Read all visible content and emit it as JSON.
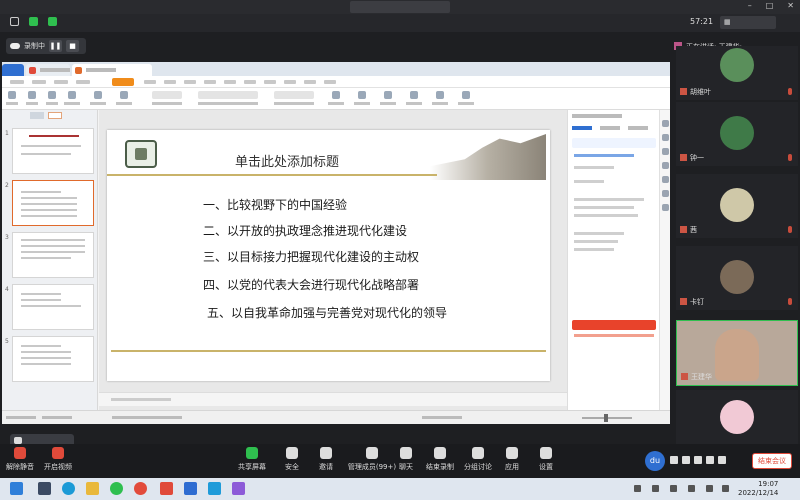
{
  "meeting": {
    "time": "57:21",
    "recording_label": "录制中",
    "speaking_label": "正在讲话: 王建华;"
  },
  "slide": {
    "title": "单击此处添加标题",
    "items": [
      "一、比较视野下的中国经验",
      "二、以开放的执政理念推进现代化建设",
      "三、以目标接力把握现代化建设的主动权",
      "四、以党的代表大会进行现代化战略部署",
      "五、以自我革命加强与完善党对现代化的领导"
    ]
  },
  "participants": [
    {
      "name": "胡维叶",
      "color": "#5a8f5b"
    },
    {
      "name": "钟一",
      "color": "#3f7a48"
    },
    {
      "name": "茜",
      "color": "#cfc8a8"
    },
    {
      "name": "卡钉",
      "color": "#7b6a58"
    },
    {
      "name": "王建华",
      "color": "#caa58b"
    },
    {
      "name": "",
      "color": "#f1c9d5"
    }
  ],
  "toolbar": {
    "unmute": "解除静音",
    "video": "开启视频",
    "share": "共享屏幕",
    "security": "安全",
    "invite": "邀请",
    "members": "管理成员(99+)",
    "chat": "聊天",
    "record": "结束录制",
    "group": "分组讨论",
    "apps": "应用",
    "settings": "设置",
    "leave": "结束会议",
    "du_label": "du"
  },
  "taskbar": {
    "time": "19:07",
    "date": "2022/12/14"
  }
}
